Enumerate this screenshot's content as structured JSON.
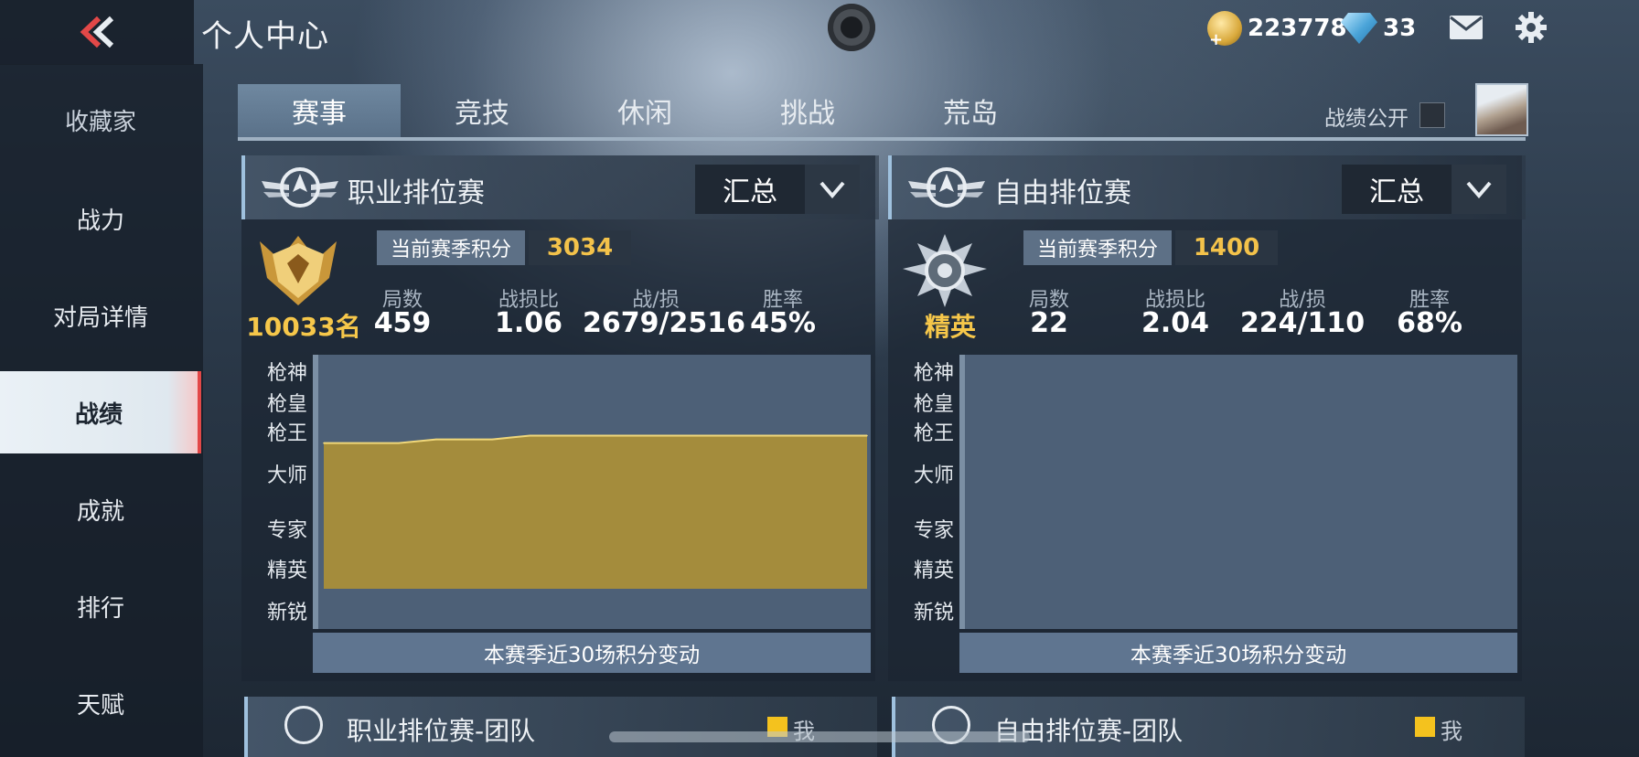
{
  "header": {
    "title": "个人中心",
    "coins": "223778",
    "diamonds": "33"
  },
  "sidebar": {
    "items": [
      {
        "label": "收藏家"
      },
      {
        "label": "战力"
      },
      {
        "label": "对局详情"
      },
      {
        "label": "战绩"
      },
      {
        "label": "成就"
      },
      {
        "label": "排行"
      },
      {
        "label": "天赋"
      }
    ],
    "active": "战绩"
  },
  "tabs": [
    {
      "label": "赛事"
    },
    {
      "label": "竞技"
    },
    {
      "label": "休闲"
    },
    {
      "label": "挑战"
    },
    {
      "label": "荒岛"
    }
  ],
  "active_tab": "赛事",
  "public_label": "战绩公开",
  "panels": [
    {
      "title": "职业排位赛",
      "filter": "汇总",
      "season_label": "当前赛季积分",
      "season_score": "3034",
      "rank": "10033名",
      "stats": [
        {
          "label": "局数",
          "value": "459"
        },
        {
          "label": "战损比",
          "value": "1.06"
        },
        {
          "label": "战/损",
          "value": "2679/2516"
        },
        {
          "label": "胜率",
          "value": "45%"
        }
      ],
      "tiers": [
        "枪神",
        "枪皇",
        "枪王",
        "大师",
        "专家",
        "精英",
        "新锐"
      ],
      "caption": "本赛季近30场积分变动"
    },
    {
      "title": "自由排位赛",
      "filter": "汇总",
      "season_label": "当前赛季积分",
      "season_score": "1400",
      "rank": "精英",
      "stats": [
        {
          "label": "局数",
          "value": "22"
        },
        {
          "label": "战损比",
          "value": "2.04"
        },
        {
          "label": "战/损",
          "value": "224/110"
        },
        {
          "label": "胜率",
          "value": "68%"
        }
      ],
      "tiers": [
        "枪神",
        "枪皇",
        "枪王",
        "大师",
        "专家",
        "精英",
        "新锐"
      ],
      "caption": "本赛季近30场积分变动"
    }
  ],
  "team_panels": [
    {
      "title": "职业排位赛-团队",
      "legend": "我"
    },
    {
      "title": "自由排位赛-团队",
      "legend": "我"
    }
  ],
  "chart_data": {
    "type": "area",
    "series": [
      {
        "values": [
          4,
          4,
          4,
          4,
          4,
          4.05,
          4.1,
          4.1,
          4.1,
          4.1,
          4.15,
          4.2,
          4.2,
          4.2,
          4.2,
          4.2,
          4.2,
          4.2,
          4.2,
          4.2,
          4.2,
          4.2,
          4.2,
          4.2,
          4.2,
          4.2,
          4.2,
          4.2,
          4.2,
          4.2
        ]
      }
    ],
    "y_categories": [
      "新锐",
      "精英",
      "专家",
      "大师",
      "枪王",
      "枪皇",
      "枪神"
    ],
    "caption": "本赛季近30场积分变动",
    "fill_color": "#a48c3c",
    "line_color": "#f0d77a"
  },
  "colors": {
    "accent_gold": "#f3c24a",
    "active_marker": "#e24848"
  },
  "icons": [
    "back-chevron-icon",
    "coin-icon",
    "diamond-icon",
    "mail-icon",
    "gear-icon",
    "camera-icon",
    "emblem-icon",
    "chevron-down-icon",
    "team-icon",
    "rank-badge-icon"
  ]
}
